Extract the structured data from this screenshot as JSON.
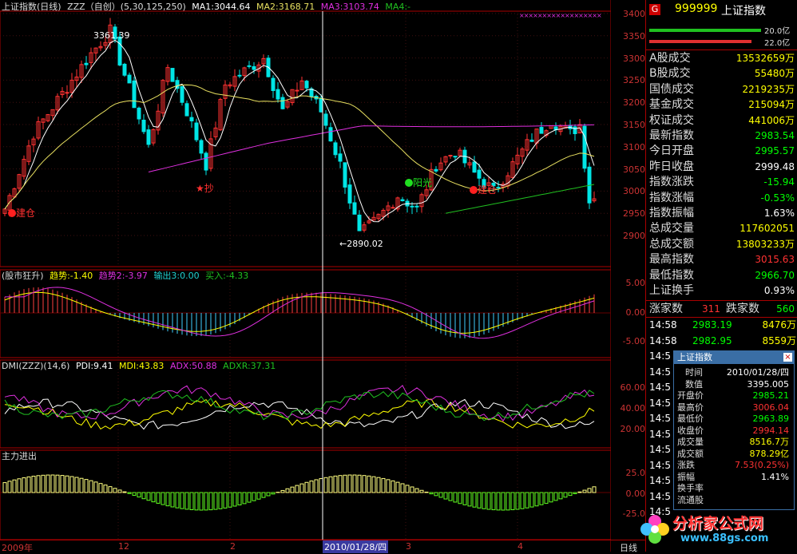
{
  "colors": {
    "up": "#ff3232",
    "down": "#00e5e5",
    "ma1": "#ffffff",
    "ma2": "#e8e060",
    "ma3": "#e030e0",
    "ma4": "#20c020",
    "axis_red": "#cc3333"
  },
  "main_header": {
    "title": "上证指数(日线)",
    "formula": "ZZZ（自创）(5,30,125,250)",
    "ma1": "MA1:3044.64",
    "ma2": "MA2:3168.71",
    "ma3": "MA3:3103.74",
    "ma4": "MA4:-"
  },
  "main_annotations": {
    "high": "3361.39",
    "low": "←2890.02",
    "signal_buy1": "建仓",
    "signal_buy2": "建仓",
    "signal_star": "★抄",
    "signal_sun": "阳光"
  },
  "main_axis": [
    "3400",
    "3350",
    "3300",
    "3250",
    "3200",
    "3150",
    "3100",
    "3050",
    "3000",
    "2950",
    "2900"
  ],
  "panel2_header": {
    "title": "(股市狂升)",
    "trend1": "趋势:-1.40",
    "trend2": "趋势2:-3.97",
    "output": "输出3:0.00",
    "buy": "买入:-4.33"
  },
  "panel2_axis": [
    "5.00",
    "0.00",
    "-5.00"
  ],
  "panel3_header": {
    "title": "DMI(ZZZ)(14,6)",
    "pdi": "PDI:9.41",
    "mdi": "MDI:43.83",
    "adx": "ADX:50.88",
    "adxr": "ADXR:37.31"
  },
  "panel3_axis": [
    "60.00",
    "40.00",
    "20.00"
  ],
  "panel4_header": {
    "title": "主力进出"
  },
  "panel4_axis": [
    "25.0",
    "0.00",
    "-25.0"
  ],
  "x_axis": {
    "labels": [
      "2009年",
      "12",
      "2",
      "3",
      "4"
    ],
    "cursor_date": "2010/01/28/四",
    "period": "日线"
  },
  "sidebar": {
    "badge": "G",
    "code": "999999",
    "name": "上证指数",
    "bar1": "20.0亿",
    "bar2": "22.0亿",
    "rows": [
      {
        "label": "A股成交",
        "value": "13532659万",
        "color": "#ffff00"
      },
      {
        "label": "B股成交",
        "value": "55480万",
        "color": "#ffff00"
      },
      {
        "label": "国债成交",
        "value": "2219235万",
        "color": "#ffff00"
      },
      {
        "label": "基金成交",
        "value": "215094万",
        "color": "#ffff00"
      },
      {
        "label": "权证成交",
        "value": "441006万",
        "color": "#ffff00"
      },
      {
        "label": "最新指数",
        "value": "2983.54",
        "color": "#00ff00"
      },
      {
        "label": "今日开盘",
        "value": "2995.57",
        "color": "#00ff00"
      },
      {
        "label": "昨日收盘",
        "value": "2999.48",
        "color": "#ffffff"
      },
      {
        "label": "指数涨跌",
        "value": "-15.94",
        "color": "#00ff00"
      },
      {
        "label": "指数涨幅",
        "value": "-0.53%",
        "color": "#00ff00"
      },
      {
        "label": "指数振幅",
        "value": "1.63%",
        "color": "#ffffff"
      },
      {
        "label": "总成交量",
        "value": "117602051",
        "color": "#ffff00"
      },
      {
        "label": "总成交额",
        "value": "13803233万",
        "color": "#ffff00"
      },
      {
        "label": "最高指数",
        "value": "3015.63",
        "color": "#ff3232"
      },
      {
        "label": "最低指数",
        "value": "2966.70",
        "color": "#00ff00"
      },
      {
        "label": "上证换手",
        "value": "0.93%",
        "color": "#ffffff"
      }
    ],
    "rise_label": "涨家数",
    "rise_value": "311",
    "fall_label": "跌家数",
    "fall_value": "560",
    "ticks": [
      {
        "time": "14:58",
        "price": "2983.19",
        "vol": "8476万"
      },
      {
        "time": "14:58",
        "price": "2982.95",
        "vol": "8559万"
      },
      {
        "time": "14:5",
        "price": "",
        "vol": ""
      },
      {
        "time": "14:5",
        "price": "",
        "vol": ""
      },
      {
        "time": "14:5",
        "price": "",
        "vol": ""
      },
      {
        "time": "14:5",
        "price": "",
        "vol": ""
      },
      {
        "time": "14:5",
        "price": "",
        "vol": ""
      },
      {
        "time": "14:5",
        "price": "",
        "vol": ""
      },
      {
        "time": "14:5",
        "price": "",
        "vol": ""
      },
      {
        "time": "14:5",
        "price": "",
        "vol": ""
      },
      {
        "time": "14:5",
        "price": "",
        "vol": ""
      },
      {
        "time": "14:5",
        "price": "",
        "vol": ""
      },
      {
        "time": "14:5",
        "price": "",
        "vol": ""
      }
    ]
  },
  "popup": {
    "title": "上证指数",
    "close": "×",
    "rows": [
      {
        "label": "时间",
        "value": "2010/01/28/四",
        "color": "#ffffff"
      },
      {
        "label": "数值",
        "value": "3395.005",
        "color": "#ffffff"
      },
      {
        "label": "开盘价",
        "value": "2985.21",
        "color": "#00ff00"
      },
      {
        "label": "最高价",
        "value": "3006.04",
        "color": "#ff3232"
      },
      {
        "label": "最低价",
        "value": "2963.89",
        "color": "#00ff00"
      },
      {
        "label": "收盘价",
        "value": "2994.14",
        "color": "#ff3232"
      },
      {
        "label": "成交量",
        "value": "8516.7万",
        "color": "#ffff00"
      },
      {
        "label": "成交额",
        "value": "878.29亿",
        "color": "#ffff00"
      },
      {
        "label": "涨跌",
        "value": "7.53(0.25%)",
        "color": "#ff3232"
      },
      {
        "label": "振幅",
        "value": "1.41%",
        "color": "#ffffff"
      },
      {
        "label": "换手率",
        "value": "",
        "color": "#ffffff"
      },
      {
        "label": "流通股",
        "value": "",
        "color": "#ffffff"
      }
    ]
  },
  "watermark": {
    "name": "分析家公式网",
    "url": "www.88gs.com"
  }
}
